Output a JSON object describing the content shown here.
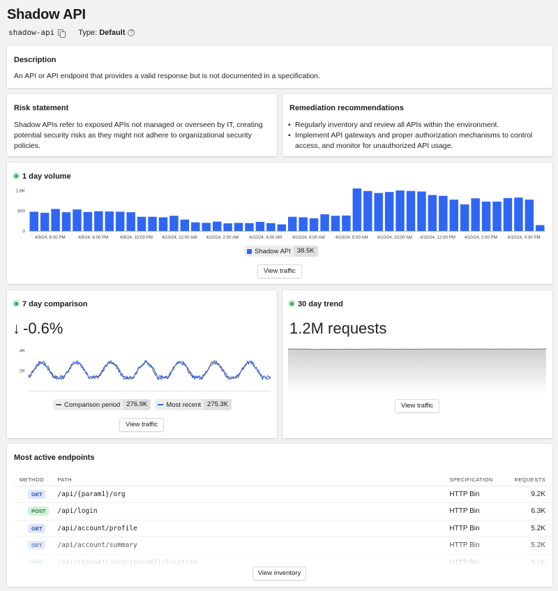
{
  "header": {
    "title": "Shadow API",
    "slug": "shadow-api",
    "type_label": "Type:",
    "type_value": "Default"
  },
  "description": {
    "title": "Description",
    "text": "An API or API endpoint that provides a valid response but is not documented in a specification."
  },
  "risk": {
    "title": "Risk statement",
    "text": "Shadow APIs refer to exposed APIs not managed or overseen by IT, creating potential security risks as they might not adhere to organizational security policies."
  },
  "remediation": {
    "title": "Remediation recommendations",
    "items": [
      "Regularly inventory and review all APIs within the environment.",
      "Implement API gateways and proper authorization mechanisms to control access, and monitor for unauthorized API usage."
    ]
  },
  "volume": {
    "title": "1 day volume",
    "legend_name": "Shadow API",
    "legend_value": "38.5K",
    "button": "View traffic"
  },
  "comparison": {
    "title": "7 day comparison",
    "arrow": "↓",
    "change": "-0.6%",
    "legend": [
      {
        "name": "Comparison period",
        "value": "276.9K"
      },
      {
        "name": "Most recent",
        "value": "275.3K"
      }
    ],
    "button": "View traffic"
  },
  "trend": {
    "title": "30 day trend",
    "headline": "1.2M requests",
    "button": "View traffic"
  },
  "endpoints": {
    "title": "Most active endpoints",
    "columns": {
      "method": "METHOD",
      "path": "PATH",
      "spec": "SPECIFICATION",
      "requests": "REQUESTS"
    },
    "rows": [
      {
        "method": "GET",
        "path": "/api/{param1}/org",
        "spec": "HTTP Bin",
        "requests": "9.2K"
      },
      {
        "method": "POST",
        "path": "/api/login",
        "spec": "HTTP Bin",
        "requests": "6.3K"
      },
      {
        "method": "GET",
        "path": "/api/account/profile",
        "spec": "HTTP Bin",
        "requests": "5.2K"
      },
      {
        "method": "GET",
        "path": "/api/account/summary",
        "spec": "HTTP Bin",
        "requests": "5.2K"
      },
      {
        "method": "GET",
        "path": "/api/{param1}/org/{param2}/location",
        "spec": "HTTP Bin",
        "requests": "5.1K"
      }
    ],
    "button": "View inventory"
  },
  "chart_data": [
    {
      "type": "bar",
      "title": "1 day volume",
      "series_color": "#2f66f5",
      "ylim": [
        0,
        1600
      ],
      "yticks": [
        "1.6K",
        "800",
        "0"
      ],
      "xticks": [
        "4/9/24, 6:00 PM",
        "4/9/24, 8:00 PM",
        "4/9/24, 10:00 PM",
        "4/10/24, 12:00 AM",
        "4/10/24, 2:00 AM",
        "4/10/24, 4:00 AM",
        "4/10/24, 6:00 AM",
        "4/10/24, 8:00 AM",
        "4/10/24, 10:00 AM",
        "4/10/24, 12:00 PM",
        "4/10/24, 2:00 PM",
        "4/10/24, 4:30 PM"
      ],
      "series": [
        {
          "name": "Shadow API",
          "values": [
            760,
            720,
            870,
            740,
            850,
            750,
            780,
            770,
            760,
            740,
            560,
            560,
            540,
            600,
            450,
            340,
            320,
            370,
            300,
            320,
            310,
            360,
            310,
            260,
            560,
            540,
            500,
            660,
            600,
            610,
            1680,
            1580,
            1500,
            1540,
            1600,
            1580,
            1560,
            1420,
            1390,
            1240,
            1050,
            1290,
            1160,
            1160,
            1300,
            1320,
            1240,
            230
          ]
        }
      ]
    },
    {
      "type": "line",
      "title": "7 day comparison",
      "yticks": [
        "4K",
        "2K"
      ],
      "ylim": [
        0,
        4000
      ],
      "series": [
        {
          "name": "Comparison period",
          "color": "#555555"
        },
        {
          "name": "Most recent",
          "color": "#2f66f5"
        }
      ]
    },
    {
      "type": "area",
      "title": "30 day trend",
      "values": [
        0.9,
        0.86,
        0.88,
        0.83,
        0.84,
        0.85,
        0.84,
        0.86,
        0.85,
        0.86,
        0.87,
        0.86,
        0.85,
        0.86,
        0.85,
        0.86,
        0.87,
        0.88,
        0.87,
        0.86,
        0.87,
        0.88,
        0.87,
        0.86,
        0.87,
        0.86,
        0.87,
        0.86,
        0.87,
        0.89
      ]
    }
  ]
}
